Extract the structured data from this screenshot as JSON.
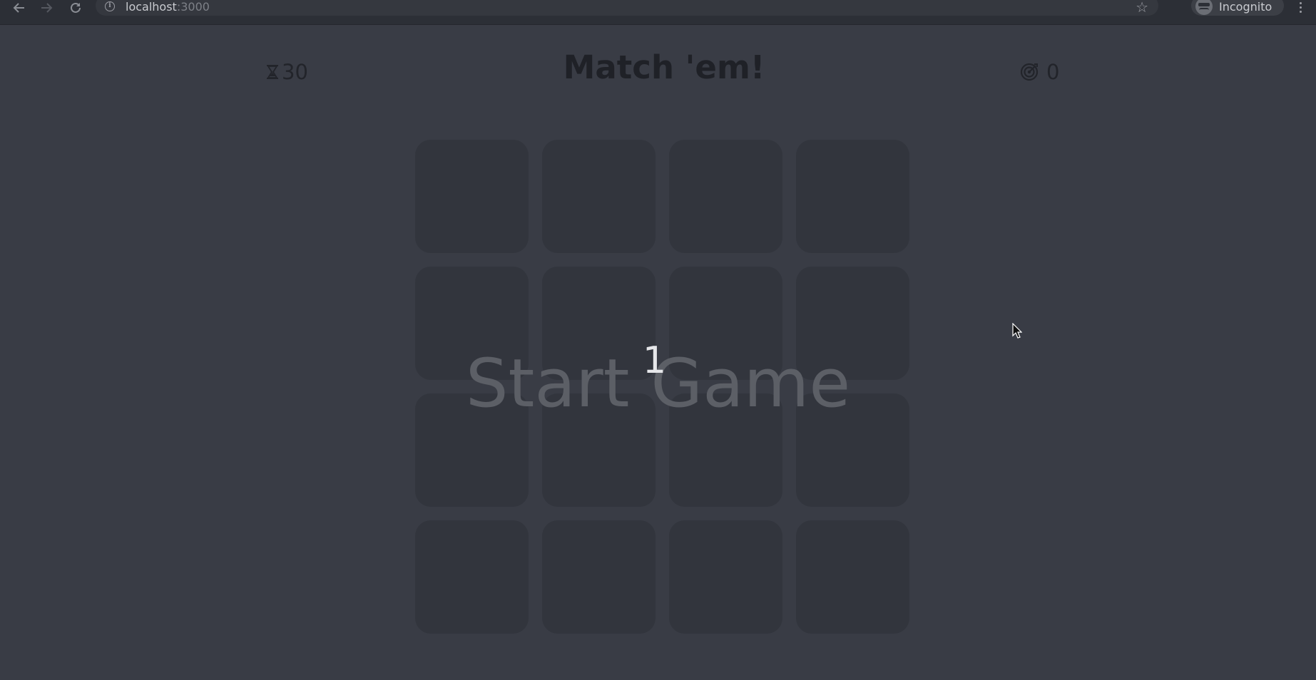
{
  "browser": {
    "url_host": "localhost",
    "url_port": ":3000",
    "profile_label": "Incognito",
    "icons": {
      "back": "arrow-left-icon",
      "forward": "arrow-right-icon",
      "reload": "reload-icon",
      "info": "info-icon",
      "bookmark": "star-icon",
      "profile": "incognito-icon",
      "menu": "kebab-menu-icon"
    }
  },
  "game": {
    "title": "Match 'em!",
    "timer": {
      "icon": "hourglass-icon",
      "value": "30"
    },
    "score": {
      "icon": "target-icon",
      "value": "0"
    },
    "board": {
      "rows": 4,
      "columns": 4,
      "card_count": 16
    },
    "overlay": {
      "start_label": "Start Game",
      "countdown": "1"
    }
  },
  "colors": {
    "background": "#393c45",
    "card": "#32353d",
    "title": "#1f2127",
    "start_label": "#5c5f66",
    "countdown": "#e6e7ea"
  }
}
